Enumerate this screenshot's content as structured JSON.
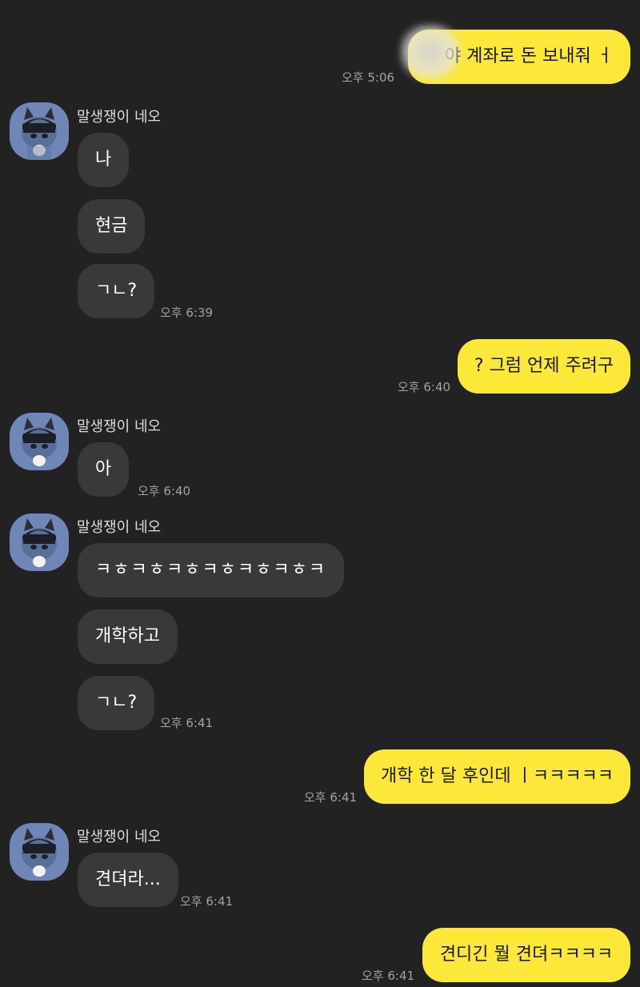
{
  "sender_name": "말생쟁이 네오",
  "colors": {
    "background": "#222222",
    "incoming_bubble": "#393939",
    "outgoing_bubble": "#fbe838",
    "avatar_bg": "#6f86b7"
  },
  "messages": {
    "m1": {
      "text": "야 계좌로 돈 보내줘 ㅓ",
      "time": "오후 5:06"
    },
    "m2": {
      "text": "나"
    },
    "m3": {
      "text": "현금"
    },
    "m4": {
      "text": "ㄱㄴ?",
      "time": "오후 6:39"
    },
    "m5": {
      "text": "? 그럼 언제 주려구",
      "time": "오후 6:40"
    },
    "m6": {
      "text": "아",
      "time": "오후 6:40"
    },
    "m7": {
      "text": "ㅋㅎㅋㅎㅋㅎㅋㅎㅋㅎㅋㅎㅋ"
    },
    "m8": {
      "text": "개학하고"
    },
    "m9": {
      "text": "ㄱㄴ?",
      "time": "오후 6:41"
    },
    "m10": {
      "text": "개학 한 달 후인데 ㅣㅋㅋㅋㅋㅋ",
      "time": "오후 6:41"
    },
    "m11": {
      "text": "견뎌라...",
      "time": "오후 6:41"
    },
    "m12": {
      "text": "견디긴 뭘 견뎌ㅋㅋㅋㅋ",
      "time": "오후 6:41"
    }
  }
}
